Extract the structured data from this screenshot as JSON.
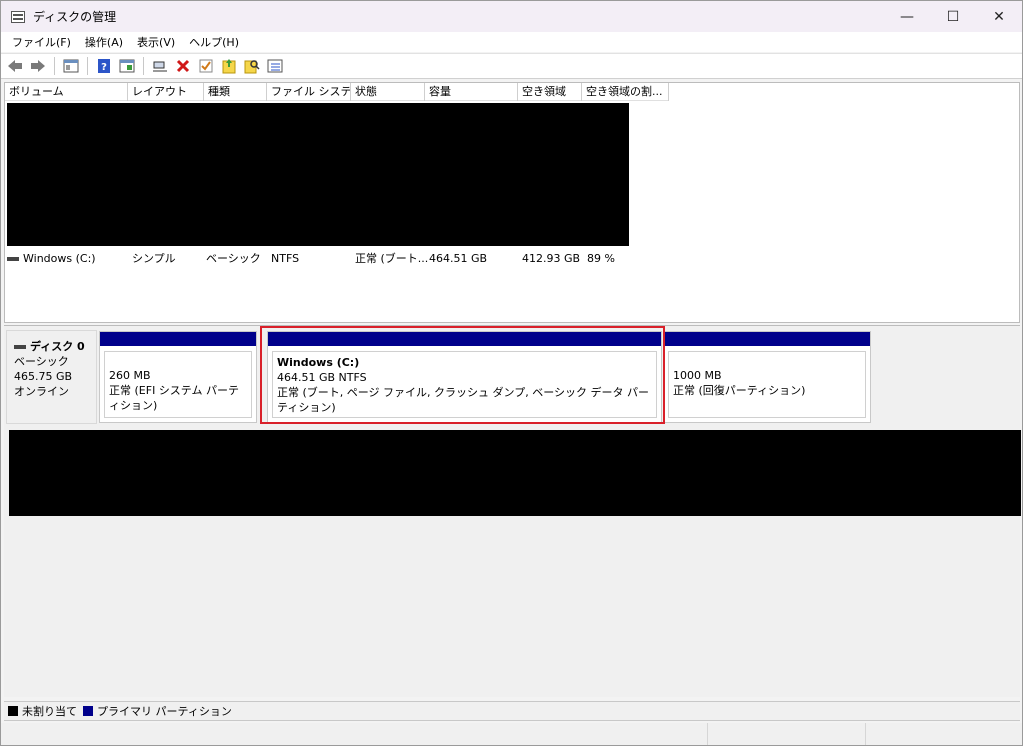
{
  "window": {
    "title": "ディスクの管理",
    "minimize": "—",
    "maximize": "☐",
    "close": "✕"
  },
  "menu": [
    "ファイル(F)",
    "操作(A)",
    "表示(V)",
    "ヘルプ(H)"
  ],
  "toolbar": {
    "icons": [
      "back-arrow-icon",
      "forward-arrow-icon",
      "console-tree-icon",
      "help-icon",
      "properties-icon",
      "connect-icon",
      "delete-icon",
      "check-icon",
      "export-icon",
      "search-icon",
      "list-view-icon"
    ]
  },
  "volume_list": {
    "columns": [
      "ボリューム",
      "レイアウト",
      "種類",
      "ファイル システム",
      "状態",
      "容量",
      "空き領域",
      "空き領域の割..."
    ],
    "rows": [
      {
        "volume": "Windows (C:)",
        "layout": "シンプル",
        "type": "ベーシック",
        "fs": "NTFS",
        "status": "正常 (ブート...",
        "capacity": "464.51 GB",
        "free": "412.93 GB",
        "free_pct": "89 %"
      }
    ]
  },
  "disk0": {
    "name": "ディスク 0",
    "type": "ベーシック",
    "size": "465.75 GB",
    "state": "オンライン",
    "partitions": [
      {
        "name": "",
        "size": "260 MB",
        "status": "正常 (EFI システム パーティション)"
      },
      {
        "name": "Windows  (C:)",
        "size": "464.51 GB NTFS",
        "status": "正常 (ブート, ページ ファイル, クラッシュ ダンプ, ベーシック データ パーティション)"
      },
      {
        "name": "",
        "size": "1000 MB",
        "status": "正常 (回復パーティション)"
      }
    ]
  },
  "legend": {
    "unallocated": "未割り当て",
    "primary": "プライマリ パーティション",
    "unallocated_color": "#000000",
    "primary_color": "#00008b"
  },
  "colors": {
    "highlight": "#d9202a",
    "partition_bar": "#00008b"
  }
}
